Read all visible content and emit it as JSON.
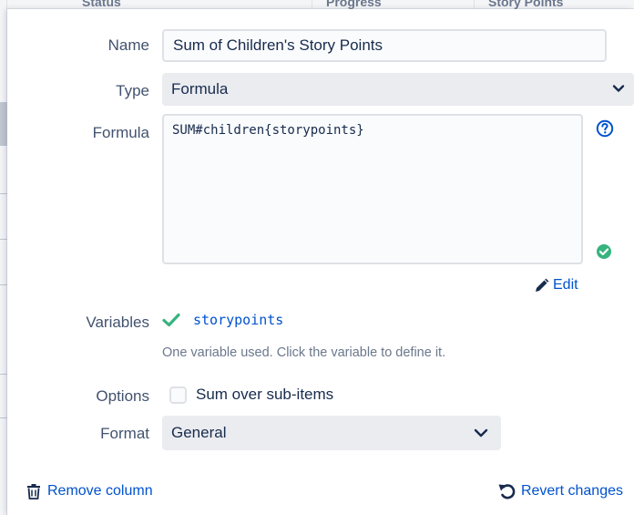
{
  "background": {
    "columns": [
      "Status",
      "Progress",
      "Story Points"
    ]
  },
  "form": {
    "name_label": "Name",
    "name_value": "Sum of Children's Story Points",
    "type_label": "Type",
    "type_value": "Formula",
    "formula_label": "Formula",
    "formula_value": "SUM#children{storypoints}",
    "edit_label": "Edit",
    "variables_label": "Variables",
    "variable_name": "storypoints",
    "variables_hint": "One variable used. Click the variable to define it.",
    "options_label": "Options",
    "option_sum_label": "Sum over sub-items",
    "option_sum_checked": false,
    "format_label": "Format",
    "format_value": "General"
  },
  "footer": {
    "remove_label": "Remove column",
    "revert_label": "Revert changes"
  },
  "colors": {
    "link": "#0052cc",
    "success": "#36b37e",
    "label": "#42526e",
    "field_bg": "#ebecf0"
  },
  "icons": [
    "chevron-down-icon",
    "help-icon",
    "check-circle-icon",
    "pencil-icon",
    "checkmark-icon",
    "trash-icon",
    "undo-icon"
  ]
}
